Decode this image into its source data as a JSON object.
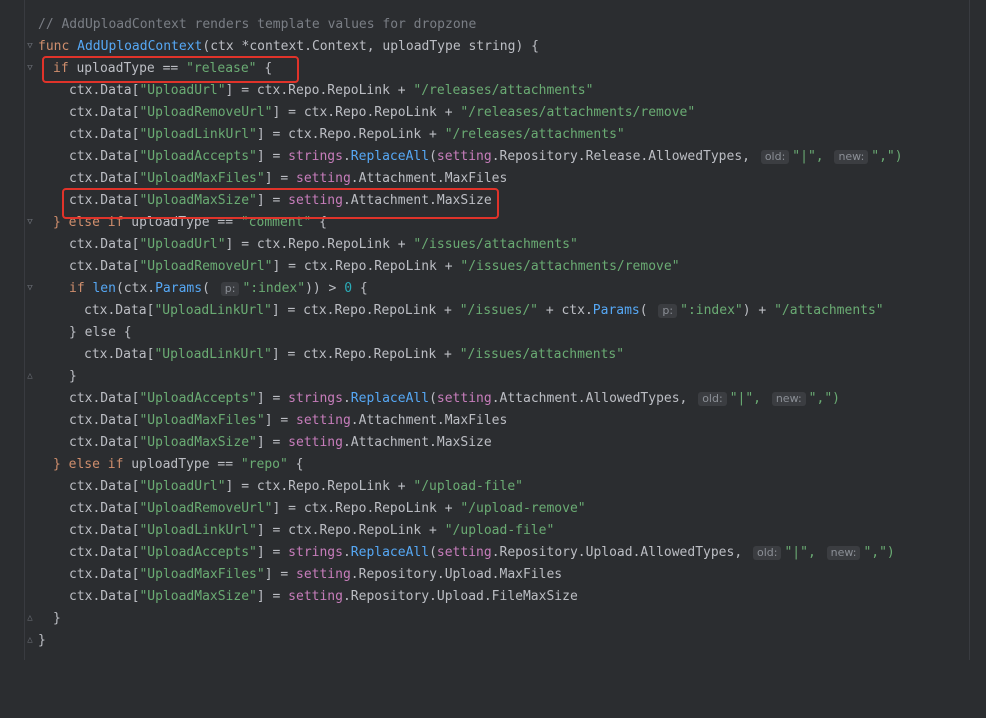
{
  "comment": "// AddUploadContext renders template values for dropzone",
  "func_kw": "func",
  "func_name": "AddUploadContext",
  "func_params": "(ctx *context.Context, uploadType string) {",
  "if_kw": "if",
  "if_cond": " uploadType == ",
  "release_str": "\"release\"",
  "brace_open": " {",
  "ctx_data": "ctx.Data[",
  "close_bracket_eq": "] = ",
  "repo_link_plus": "ctx.Repo.RepoLink + ",
  "keys": {
    "upload_url": "\"UploadUrl\"",
    "upload_remove_url": "\"UploadRemoveUrl\"",
    "upload_link_url": "\"UploadLinkUrl\"",
    "upload_accepts": "\"UploadAccepts\"",
    "upload_max_files": "\"UploadMaxFiles\"",
    "upload_max_size": "\"UploadMaxSize\""
  },
  "paths": {
    "releases_attachments": "\"/releases/attachments\"",
    "releases_attachments_remove": "\"/releases/attachments/remove\"",
    "issues_attachments": "\"/issues/attachments\"",
    "issues_attachments_remove": "\"/issues/attachments/remove\"",
    "issues": "\"/issues/\"",
    "attachments": "\"/attachments\"",
    "upload_file": "\"/upload-file\"",
    "upload_remove": "\"/upload-remove\""
  },
  "strings_pkg": "strings",
  "replace_all": "ReplaceAll",
  "setting_pkg": "setting",
  "release_allowed": ".Repository.Release.AllowedTypes,",
  "attachment_allowed": ".Attachment.AllowedTypes,",
  "upload_allowed": ".Repository.Upload.AllowedTypes,",
  "attachment_max_files": ".Attachment.MaxFiles",
  "attachment_max_size": ".Attachment.MaxSize",
  "upload_max_files_field": ".Repository.Upload.MaxFiles",
  "upload_file_max_size": ".Repository.Upload.FileMaxSize",
  "hint_old": "old:",
  "hint_new": "new:",
  "hint_p": "p:",
  "pipe_str": "\"|\",",
  "comma_str": "\",\")",
  "else_if_kw": "} else if",
  "comment_str": "\"comment\"",
  "repo_str": "\"repo\"",
  "len_fn": "len",
  "params_fn": "Params",
  "index_str": "\":index\"",
  "zero": "0",
  "else_kw": "} else {",
  "close_brace": "}"
}
